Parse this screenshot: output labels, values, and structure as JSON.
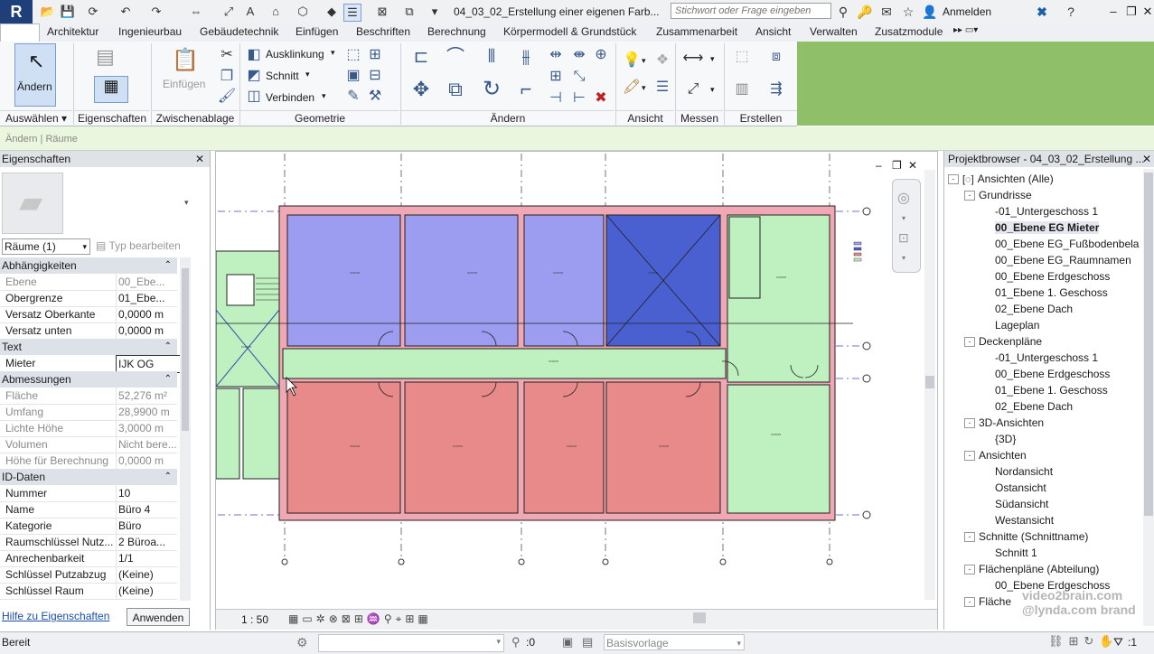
{
  "titlebar": {
    "logo": "R",
    "doc_title": "04_03_02_Erstellung einer eigenen Farb...",
    "search_placeholder": "Stichwort oder Frage eingeben",
    "login": "Anmelden"
  },
  "tabs": [
    "Architektur",
    "Ingenieurbau",
    "Gebäudetechnik",
    "Einfügen",
    "Beschriften",
    "Berechnung",
    "Körpermodell & Grundstück",
    "Zusammenarbeit",
    "Ansicht",
    "Verwalten",
    "Zusatzmodule"
  ],
  "ribbon": {
    "aendern": "Ändern",
    "einfuegen": "Einfügen",
    "ausklinkung": "Ausklinkung",
    "schnitt": "Schnitt",
    "verbinden": "Verbinden",
    "panels": [
      "Auswählen",
      "Eigenschaften",
      "Zwischenablage",
      "Geometrie",
      "Ändern",
      "Ansicht",
      "Messen",
      "Erstellen"
    ]
  },
  "optionsbar": {
    "breadcrumb": "Ändern | Räume"
  },
  "properties": {
    "title": "Eigenschaften",
    "type_selector": "Räume (1)",
    "edit_type": "Typ bearbeiten",
    "rows": [
      {
        "cat": "Abhängigkeiten"
      },
      {
        "k": "Ebene",
        "v": "00_Ebe...",
        "dim": true
      },
      {
        "k": "Obergrenze",
        "v": "01_Ebe..."
      },
      {
        "k": "Versatz Oberkante",
        "v": "0,0000 m"
      },
      {
        "k": "Versatz unten",
        "v": "0,0000 m"
      },
      {
        "cat": "Text"
      },
      {
        "k": "Mieter",
        "v": "IJK OG"
      },
      {
        "cat": "Abmessungen"
      },
      {
        "k": "Fläche",
        "v": "52,276 m²",
        "dim": true
      },
      {
        "k": "Umfang",
        "v": "28,9900 m",
        "dim": true
      },
      {
        "k": "Lichte Höhe",
        "v": "3,0000 m",
        "dim": true
      },
      {
        "k": "Volumen",
        "v": "Nicht bere...",
        "dim": true
      },
      {
        "k": "Höhe für Berechnung",
        "v": "0,0000 m",
        "dim": true
      },
      {
        "cat": "ID-Daten"
      },
      {
        "k": "Nummer",
        "v": "10"
      },
      {
        "k": "Name",
        "v": "Büro 4"
      },
      {
        "k": "Kategorie",
        "v": "Büro"
      },
      {
        "k": "Raumschlüssel Nutz...",
        "v": "2 Büroa..."
      },
      {
        "k": "Anrechenbarkeit",
        "v": "1/1"
      },
      {
        "k": "Schlüssel Putzabzug",
        "v": "(Keine)"
      },
      {
        "k": "Schlüssel Raum",
        "v": "(Keine)"
      }
    ],
    "help_link": "Hilfe zu Eigenschaften",
    "apply": "Anwenden"
  },
  "canvas": {
    "scale": "1 : 50",
    "room_colors": {
      "purple": "#9c9cf0",
      "blue": "#4a5fd0",
      "red": "#e88a8a",
      "green": "#bff0c0",
      "wall": "#f0a8b4"
    }
  },
  "browser": {
    "title": "Projektbrowser - 04_03_02_Erstellung ...",
    "nodes": [
      {
        "level": 0,
        "label": "Ansichten (Alle)",
        "toggle": "-"
      },
      {
        "level": 1,
        "label": "Grundrisse",
        "toggle": "-"
      },
      {
        "level": 2,
        "label": "-01_Untergeschoss 1"
      },
      {
        "level": 2,
        "label": "00_Ebene EG Mieter",
        "bold": true
      },
      {
        "level": 2,
        "label": "00_Ebene EG_Fußbodenbela"
      },
      {
        "level": 2,
        "label": "00_Ebene EG_Raumnamen"
      },
      {
        "level": 2,
        "label": "00_Ebene Erdgeschoss"
      },
      {
        "level": 2,
        "label": "01_Ebene 1. Geschoss"
      },
      {
        "level": 2,
        "label": "02_Ebene Dach"
      },
      {
        "level": 2,
        "label": "Lageplan"
      },
      {
        "level": 1,
        "label": "Deckenpläne",
        "toggle": "-"
      },
      {
        "level": 2,
        "label": "-01_Untergeschoss 1"
      },
      {
        "level": 2,
        "label": "00_Ebene Erdgeschoss"
      },
      {
        "level": 2,
        "label": "01_Ebene 1. Geschoss"
      },
      {
        "level": 2,
        "label": "02_Ebene Dach"
      },
      {
        "level": 1,
        "label": "3D-Ansichten",
        "toggle": "-"
      },
      {
        "level": 2,
        "label": "{3D}"
      },
      {
        "level": 1,
        "label": "Ansichten",
        "toggle": "-"
      },
      {
        "level": 2,
        "label": "Nordansicht"
      },
      {
        "level": 2,
        "label": "Ostansicht"
      },
      {
        "level": 2,
        "label": "Südansicht"
      },
      {
        "level": 2,
        "label": "Westansicht"
      },
      {
        "level": 1,
        "label": "Schnitte (Schnittname)",
        "toggle": "-"
      },
      {
        "level": 2,
        "label": "Schnitt 1"
      },
      {
        "level": 1,
        "label": "Flächenpläne (Abteilung)",
        "toggle": "-"
      },
      {
        "level": 2,
        "label": "00_Ebene Erdgeschoss"
      },
      {
        "level": 1,
        "label": "Fläche",
        "toggle": "-"
      }
    ]
  },
  "status": {
    "text": "Bereit",
    "filter_count": ":0",
    "base_template": "Basisvorlage",
    "select_count": ":1"
  },
  "watermark": "video2brain.com\n@lynda.com brand"
}
